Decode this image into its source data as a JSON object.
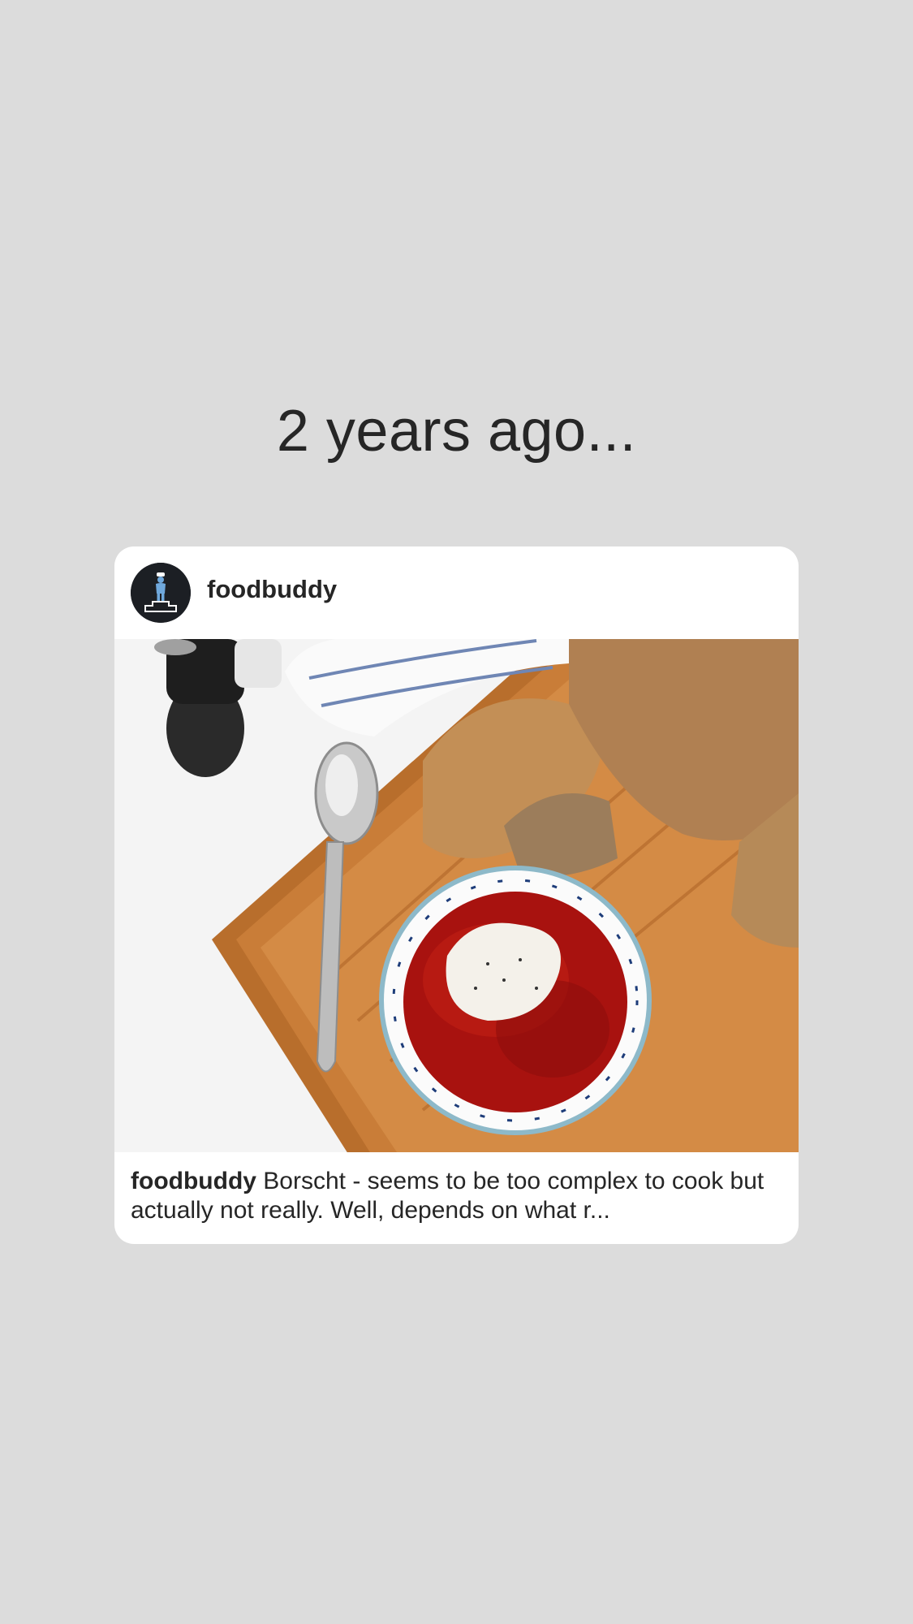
{
  "memory": {
    "title": "2 years ago..."
  },
  "post": {
    "username": "foodbuddy",
    "avatar_icon": "chef-on-podium-icon",
    "photo_subject": "bowl-of-borscht-with-bread-on-cutting-board",
    "caption_username": "foodbuddy",
    "caption_text": "Borscht - seems to be too complex to cook but actually not really. Well, depends on what r..."
  },
  "colors": {
    "background": "#dcdcdc",
    "card": "#ffffff",
    "text": "#262626",
    "avatar_bg": "#1c1f24",
    "avatar_figure": "#6fa8dc"
  }
}
